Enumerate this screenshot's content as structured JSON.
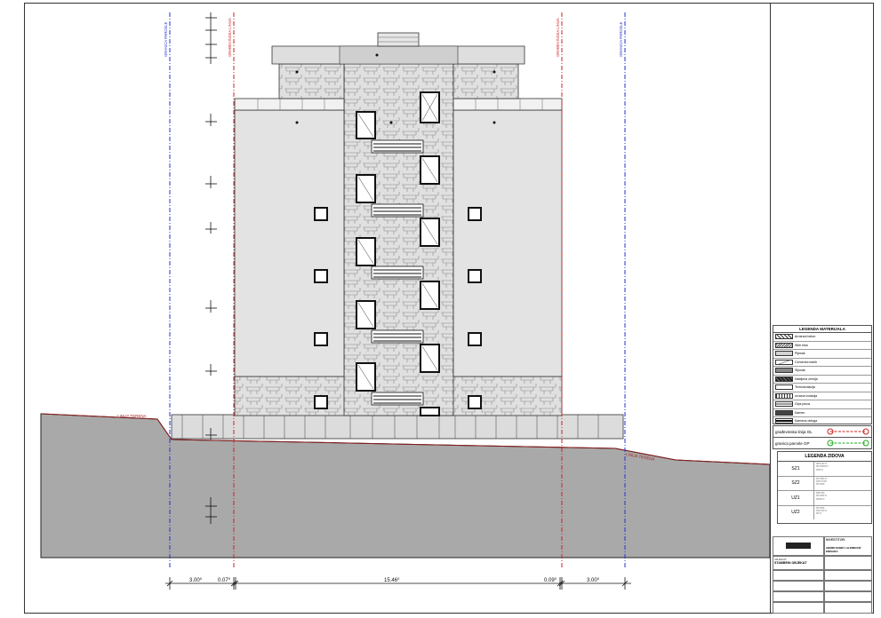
{
  "drawing": {
    "boundary_labels": {
      "parcel_left": "GRANICA PARCELE",
      "parcel_right": "GRANICA PARCELE",
      "building_line_left": "GRAĐEVINSKA LINIJA",
      "building_line_right": "GRAĐEVINSKA LINIJA"
    },
    "terrain_labels": {
      "left": "LINIJA TERENA",
      "right": "LINIJA TERENA"
    },
    "dimensions": {
      "d1": "3.00⁰",
      "d2": "0.07⁰",
      "d3": "15.46⁰",
      "d4": "0.09⁰",
      "d5": "3.00⁰"
    },
    "colors": {
      "parcel_line": "#2233cc",
      "building_line": "#cc2222",
      "terrain": "#a8a8a8",
      "facade_plaster": "#e3e3e3",
      "stone": "#dcdcdc"
    }
  },
  "materials_legend": {
    "title": "LEGENDA MATERIJALA",
    "items": [
      "Armirani beton",
      "Siter blok",
      "Pijesak",
      "Cementni estrih",
      "Sljunak",
      "Nabijena zemlja",
      "Termoizolacija",
      "zvucna izolacija",
      "Gips ploca",
      "Kamen",
      "Kamena obloga"
    ]
  },
  "boundary_legend": {
    "building_line": "građevinska linija GL",
    "parcel_line": "granica parcele GP"
  },
  "walls_legend": {
    "title": "LEGENDA ZIDOVA",
    "rows": [
      {
        "code": "SZ1"
      },
      {
        "code": "SZ2"
      },
      {
        "code": "UZ1"
      },
      {
        "code": "UZ2"
      }
    ]
  },
  "title_block": {
    "investor_label": "INVESTITOR:",
    "investor_value": "ADMIR RAMIĆ I ALDIMOVIĆ ENISADA",
    "object_label": "OBJEKAT:",
    "object_value": "STAMBENI OBJEKAT"
  }
}
